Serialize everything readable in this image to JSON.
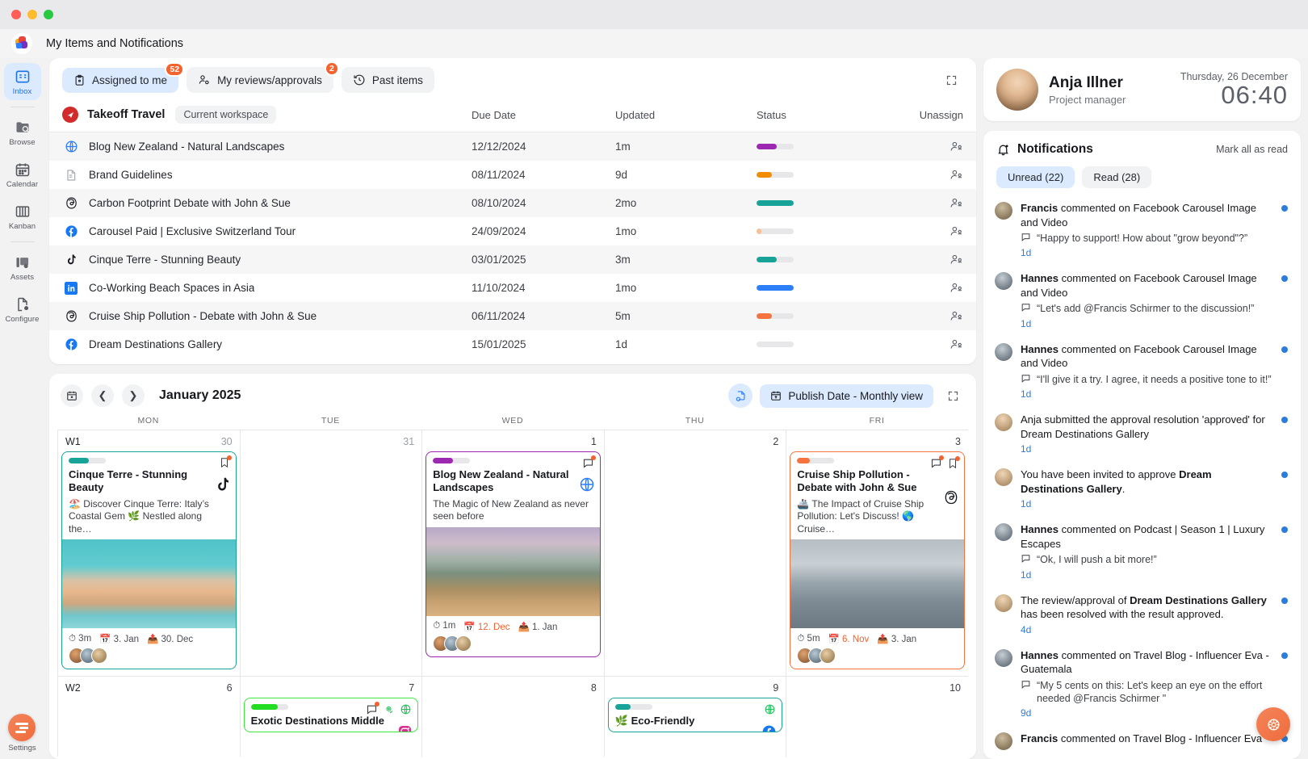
{
  "window": {
    "title": "My Items and Notifications"
  },
  "rail": {
    "items": [
      {
        "label": "Inbox",
        "icon": "inbox-icon",
        "active": true
      },
      {
        "label": "Browse",
        "icon": "browse-icon",
        "active": false
      },
      {
        "label": "Calendar",
        "icon": "calendar-icon",
        "active": false
      },
      {
        "label": "Kanban",
        "icon": "kanban-icon",
        "active": false
      },
      {
        "label": "Assets",
        "icon": "assets-icon",
        "active": false
      },
      {
        "label": "Configure",
        "icon": "configure-icon",
        "active": false
      }
    ],
    "settings_label": "Settings"
  },
  "inbox": {
    "tabs": [
      {
        "label": "Assigned to me",
        "badge": "52",
        "active": true,
        "icon": "clipboard-icon"
      },
      {
        "label": "My reviews/approvals",
        "badge": "2",
        "active": false,
        "icon": "user-check-icon"
      },
      {
        "label": "Past items",
        "badge": "",
        "active": false,
        "icon": "history-icon"
      }
    ],
    "workspace": {
      "name": "Takeoff Travel",
      "chip": "Current workspace"
    },
    "columns": {
      "due": "Due Date",
      "updated": "Updated",
      "status": "Status",
      "unassign": "Unassign"
    },
    "rows": [
      {
        "icon": "globe-icon",
        "name": "Blog New Zealand - Natural Landscapes",
        "due": "12/12/2024",
        "updated": "1m",
        "status_color": "#9c27b0",
        "status_pct": 55
      },
      {
        "icon": "document-icon",
        "name": "Brand Guidelines",
        "due": "08/11/2024",
        "updated": "9d",
        "status_color": "#f28c00",
        "status_pct": 42
      },
      {
        "icon": "threads-icon",
        "name": "Carbon Footprint Debate with John & Sue",
        "due": "08/10/2024",
        "updated": "2mo",
        "status_color": "#17a398",
        "status_pct": 100
      },
      {
        "icon": "facebook-icon",
        "name": "Carousel Paid | Exclusive Switzerland Tour",
        "due": "24/09/2024",
        "updated": "1mo",
        "status_color": "#fac091",
        "status_pct": 13
      },
      {
        "icon": "tiktok-icon",
        "name": "Cinque Terre - Stunning Beauty",
        "due": "03/01/2025",
        "updated": "3m",
        "status_color": "#17a398",
        "status_pct": 55
      },
      {
        "icon": "linkedin-icon",
        "name": "Co-Working Beach Spaces in Asia",
        "due": "11/10/2024",
        "updated": "1mo",
        "status_color": "#2d7ff9",
        "status_pct": 100
      },
      {
        "icon": "threads-icon",
        "name": "Cruise Ship Pollution - Debate with John & Sue",
        "due": "06/11/2024",
        "updated": "5m",
        "status_color": "#f4733e",
        "status_pct": 42
      },
      {
        "icon": "facebook-icon",
        "name": "Dream Destinations Gallery",
        "due": "15/01/2025",
        "updated": "1d",
        "status_color": "#e7e7e9",
        "status_pct": 0
      }
    ]
  },
  "calendar": {
    "month_title": "January 2025",
    "view_chip": "Publish Date - Monthly view",
    "weekdays": [
      "MON",
      "TUE",
      "WED",
      "THU",
      "FRI"
    ],
    "weeks": [
      {
        "label": "W1",
        "days": [
          {
            "num": "30",
            "muted": true
          },
          {
            "num": "31",
            "muted": true
          },
          {
            "num": "1",
            "muted": false
          },
          {
            "num": "2",
            "muted": false
          },
          {
            "num": "3",
            "muted": false
          }
        ]
      },
      {
        "label": "W2",
        "days": [
          {
            "num": "6",
            "muted": false
          },
          {
            "num": "7",
            "muted": false
          },
          {
            "num": "8",
            "muted": false
          },
          {
            "num": "9",
            "muted": false
          },
          {
            "num": "10",
            "muted": false
          }
        ]
      }
    ],
    "events": [
      {
        "day": 0,
        "week": 0,
        "title": "Cinque Terre - Stunning Beauty",
        "desc": "🏖️ Discover Cinque Terre: Italy’s Coastal Gem 🌿 Nestled along the…",
        "border": "#17a398",
        "bar_color": "#17a398",
        "bar_pct": 55,
        "brand": "tiktok-icon",
        "flag_icon": "bookmark-icon",
        "duration": "3m",
        "due": "3. Jan",
        "due_overdue": false,
        "publish": "30. Dec",
        "image": "cinque"
      },
      {
        "day": 2,
        "week": 0,
        "title": "Blog New Zealand - Natural Landscapes",
        "desc": "The Magic of New Zealand as never seen before",
        "border": "#9c27b0",
        "bar_color": "#9c27b0",
        "bar_pct": 55,
        "brand": "globe-icon",
        "flag_icon": "comment-icon",
        "duration": "1m",
        "due": "12. Dec",
        "due_overdue": true,
        "publish": "1. Jan",
        "image": "nz"
      },
      {
        "day": 4,
        "week": 0,
        "title": "Cruise Ship Pollution - Debate with John & Sue",
        "desc": "🚢 The Impact of Cruise Ship Pollution: Let's Discuss! 🌎 Cruise…",
        "border": "#f4733e",
        "bar_color": "#f4733e",
        "bar_pct": 35,
        "brand": "threads-icon",
        "flag_icon": "comment-icon",
        "duration": "5m",
        "due": "6. Nov",
        "due_overdue": true,
        "publish": "3. Jan",
        "image": "cruise"
      },
      {
        "day": 1,
        "week": 1,
        "title": "Exotic Destinations Middle",
        "border": "#3ee63e",
        "bar_color": "#22dd22",
        "bar_pct": 72,
        "brand": "instagram-icon",
        "flag_icon": "comment-icon",
        "extra_icons": [
          "eye-check-icon",
          "globe-green-icon"
        ]
      },
      {
        "day": 3,
        "week": 1,
        "title": "🌿 Eco-Friendly",
        "border": "#17a398",
        "bar_color": "#17a398",
        "bar_pct": 42,
        "brand": "facebook-icon",
        "extra_icons": [
          "globe-green-icon"
        ]
      }
    ]
  },
  "user": {
    "name": "Anja Illner",
    "role": "Project manager",
    "date": "Thursday, 26 December",
    "time": "06:40"
  },
  "notifications": {
    "title": "Notifications",
    "mark_all": "Mark all as read",
    "filters": [
      {
        "label": "Unread (22)",
        "active": true
      },
      {
        "label": "Read (28)",
        "active": false
      }
    ],
    "items": [
      {
        "actor": "Francis",
        "action": " commented on ",
        "target": "Facebook Carousel Image and Video",
        "target_bold": false,
        "quote": "“Happy to support! How about \"grow beyond\"?”",
        "time": "1d",
        "unread": true,
        "avatar": "francis"
      },
      {
        "actor": "Hannes",
        "action": " commented on ",
        "target": "Facebook Carousel Image and Video",
        "target_bold": false,
        "quote": "“Let's add @Francis Schirmer to the discussion!”",
        "time": "1d",
        "unread": true,
        "avatar": "hannes"
      },
      {
        "actor": "Hannes",
        "action": " commented on ",
        "target": "Facebook Carousel Image and Video",
        "target_bold": false,
        "quote": "“I'll give it a try. I agree, it needs a positive tone to it!”",
        "time": "1d",
        "unread": true,
        "avatar": "hannes"
      },
      {
        "actor": "",
        "action": "Anja submitted the approval resolution 'approved' for Dream Destinations Gallery",
        "target": "",
        "target_bold": false,
        "quote": "",
        "time": "1d",
        "unread": true,
        "avatar": "anja"
      },
      {
        "actor": "",
        "action": "You have been invited to approve ",
        "target": "Dream Destinations Gallery",
        "target_bold": true,
        "suffix": ".",
        "quote": "",
        "time": "1d",
        "unread": true,
        "avatar": "anja"
      },
      {
        "actor": "Hannes",
        "action": " commented on ",
        "target": "Podcast | Season 1 | Luxury Escapes",
        "target_bold": false,
        "quote": "“Ok, I will push a bit more!”",
        "time": "1d",
        "unread": true,
        "avatar": "hannes"
      },
      {
        "actor": "",
        "action": "The review/approval of ",
        "target": "Dream Destinations Gallery",
        "target_bold": true,
        "suffix": " has been resolved with the result approved.",
        "quote": "",
        "time": "4d",
        "unread": true,
        "avatar": "anja"
      },
      {
        "actor": "Hannes",
        "action": " commented on ",
        "target": "Travel Blog - Influencer Eva - Guatemala",
        "target_bold": false,
        "quote": "“My 5 cents on this: Let's keep an eye on the effort needed @Francis Schirmer \"",
        "time": "9d",
        "unread": true,
        "avatar": "hannes"
      },
      {
        "actor": "Francis",
        "action": " commented on ",
        "target": "Travel Blog - Influencer Eva",
        "target_bold": false,
        "quote": "",
        "time": "",
        "unread": true,
        "avatar": "francis"
      }
    ]
  },
  "colors": {
    "accent": "#2d7ff9",
    "accent_light": "#dbeafe",
    "orange": "#f4622e",
    "teal": "#17a398",
    "purple": "#9c27b0"
  }
}
